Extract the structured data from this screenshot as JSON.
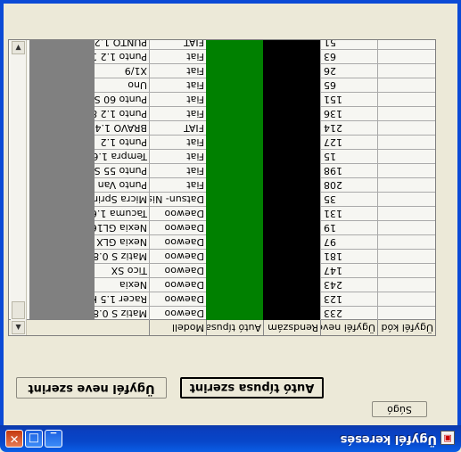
{
  "window": {
    "title": "Ügyfél keresés",
    "minimize_glyph": "_",
    "maximize_glyph": "□",
    "close_glyph": "✕"
  },
  "buttons": {
    "by_client_name": "Ügyfél neve szerint",
    "by_car_type": "Autó típusa szerint",
    "help": "Súgó"
  },
  "grid": {
    "columns": [
      "Ügyfél kód",
      "Ügyfél neve",
      "Rendszám",
      "Autó típusa",
      "Modell"
    ],
    "rows": [
      {
        "kod": "233",
        "marka": "Daewoo",
        "modell": "Matiz S 0.8"
      },
      {
        "kod": "123",
        "marka": "Daewoo",
        "modell": "Racer 1.5 K"
      },
      {
        "kod": "243",
        "marka": "Daewoo",
        "modell": "Nexia"
      },
      {
        "kod": "147",
        "marka": "Daewoo",
        "modell": "Tico SX"
      },
      {
        "kod": "181",
        "marka": "Daewoo",
        "modell": "Matiz S 0.8"
      },
      {
        "kod": "97",
        "marka": "Daewoo",
        "modell": "Nexia GLX"
      },
      {
        "kod": "19",
        "marka": "Daewoo",
        "modell": "Nexia GL16I"
      },
      {
        "kod": "131",
        "marka": "Daewoo",
        "modell": "Tacuma 1.6"
      },
      {
        "kod": "35",
        "marka": "Datsun- Niss",
        "modell": "Micra Sprint"
      },
      {
        "kod": "208",
        "marka": "Fiat",
        "modell": "Punto Van 5"
      },
      {
        "kod": "198",
        "marka": "Fiat",
        "modell": "Punto 55 SC"
      },
      {
        "kod": "15",
        "marka": "Fiat",
        "modell": "Tempra 1.6"
      },
      {
        "kod": "127",
        "marka": "Fiat",
        "modell": "Punto 1.2"
      },
      {
        "kod": "214",
        "marka": "FIAT",
        "modell": "BRAVO 1.4"
      },
      {
        "kod": "136",
        "marka": "Fiat",
        "modell": "Punto 1.2 8/"
      },
      {
        "kod": "151",
        "marka": "Fiat",
        "modell": "Punto 60 SX"
      },
      {
        "kod": "65",
        "marka": "Fiat",
        "modell": "Uno"
      },
      {
        "kod": "26",
        "marka": "Fiat",
        "modell": "X1/9"
      },
      {
        "kod": "63",
        "marka": "Fiat",
        "modell": "Punto 1.2 16"
      },
      {
        "kod": "51",
        "marka": "FIAT",
        "modell": "PUNTO 1.2"
      }
    ]
  },
  "icons": {
    "app": "app-window-icon",
    "scroll_up": "scroll-up-arrow-icon",
    "scroll_down": "scroll-down-arrow-icon"
  }
}
